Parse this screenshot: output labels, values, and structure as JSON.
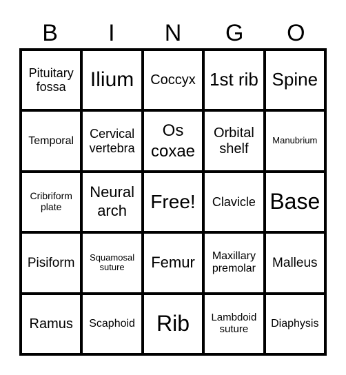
{
  "header": [
    "B",
    "I",
    "N",
    "G",
    "O"
  ],
  "board": [
    [
      "Pituitary fossa",
      "Ilium",
      "Coccyx",
      "1st rib",
      "Spine"
    ],
    [
      "Temporal",
      "Cervical vertebra",
      "Os coxae",
      "Orbital shelf",
      "Manubrium"
    ],
    [
      "Cribriform plate",
      "Neural arch",
      "Free!",
      "Clavicle",
      "Base"
    ],
    [
      "Pisiform",
      "Squamosal suture",
      "Femur",
      "Maxillary premolar",
      "Malleus"
    ],
    [
      "Ramus",
      "Scaphoid",
      "Rib",
      "Lambdoid suture",
      "Diaphysis"
    ]
  ],
  "free_space": "Free!"
}
